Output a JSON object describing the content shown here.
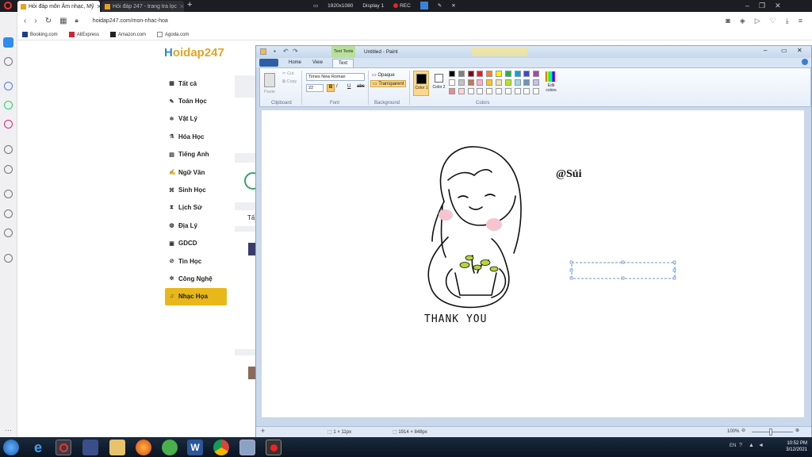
{
  "browser": {
    "tabs": [
      {
        "title": "Hỏi đáp môn Âm nhạc, Mỹ"
      },
      {
        "title": "Hỏi đáp 247 - trang tra lọc"
      }
    ],
    "url": "hoidap247.com/mon-nhac-hoa",
    "bookmarks": [
      "Booking.com",
      "AliExpress",
      "Amazon.com",
      "Agoda.com"
    ],
    "recorder": {
      "resolution": "1920x1080",
      "display": "Display 1",
      "rec": "REC"
    }
  },
  "site": {
    "logo_h": "H",
    "logo_rest": "oidap247",
    "nav": [
      {
        "icon": "grid-icon",
        "glyph": "▦",
        "label": "Tất cả"
      },
      {
        "icon": "math-icon",
        "glyph": "✎",
        "label": "Toán Học"
      },
      {
        "icon": "atom-icon",
        "glyph": "⚛",
        "label": "Vật Lý"
      },
      {
        "icon": "flask-icon",
        "glyph": "⚗",
        "label": "Hóa Học"
      },
      {
        "icon": "language-icon",
        "glyph": "▤",
        "label": "Tiếng Anh"
      },
      {
        "icon": "pen-icon",
        "glyph": "✍",
        "label": "Ngữ Văn"
      },
      {
        "icon": "dna-icon",
        "glyph": "⌘",
        "label": "Sinh Học"
      },
      {
        "icon": "history-icon",
        "glyph": "⧗",
        "label": "Lịch Sử"
      },
      {
        "icon": "globe-icon",
        "glyph": "◍",
        "label": "Địa Lý"
      },
      {
        "icon": "book-icon",
        "glyph": "▣",
        "label": "GDCD"
      },
      {
        "icon": "computer-icon",
        "glyph": "⊘",
        "label": "Tin Học"
      },
      {
        "icon": "gear-icon",
        "glyph": "✲",
        "label": "Công Nghệ"
      },
      {
        "icon": "music-icon",
        "glyph": "♫",
        "label": "Nhạc Họa"
      }
    ],
    "selected_nav": "Nhạc Họa",
    "partial_text": "Tấ",
    "accent": "#e8b81a"
  },
  "paint": {
    "title": "Untitled - Paint",
    "context_tab": "Text Tools",
    "tabs": [
      "Home",
      "View",
      "Text"
    ],
    "clipboard": {
      "paste": "Paste",
      "cut": "Cut",
      "copy": "Copy",
      "label": "Clipboard"
    },
    "font": {
      "name": "Times New Roman",
      "size": "22",
      "label": "Font"
    },
    "background": {
      "opaque": "Opaque",
      "transparent": "Transparent",
      "label": "Background"
    },
    "colors": {
      "color1": "Color 1",
      "color2": "Color 2",
      "label": "Colors",
      "edit": "Edit colors"
    },
    "palette": [
      "#000000",
      "#7f7f7f",
      "#880015",
      "#ed1c24",
      "#ff7f27",
      "#fff200",
      "#22b14c",
      "#00a2e8",
      "#3f48cc",
      "#a349a4",
      "#ffffff",
      "#c3c3c3",
      "#b97a57",
      "#ffaec9",
      "#ffc90e",
      "#efe4b0",
      "#b5e61d",
      "#99d9ea",
      "#7092be",
      "#c8bfe7",
      "#ef8a8a",
      "#ffd3d3",
      "#ffffff",
      "#ffffff",
      "#ffffff",
      "#ffffff",
      "#ffffff",
      "#ffffff",
      "#ffffff",
      "#ffffff"
    ],
    "canvas_text": "@Sủi",
    "drawing_text": "THANK YOU",
    "status": {
      "cursor": "1 × 11px",
      "size": "1914 × 848px",
      "zoom": "100%"
    }
  },
  "taskbar": {
    "time": "10:52 PM",
    "date": "3/12/2021",
    "lang": "EN"
  }
}
